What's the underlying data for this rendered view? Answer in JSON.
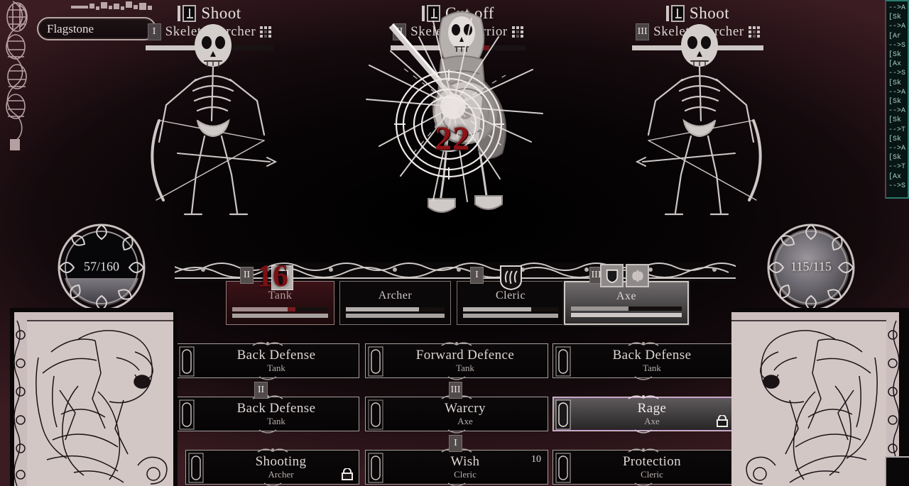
{
  "location": {
    "name": "Flagstone"
  },
  "enemies": [
    {
      "intent": "Shoot",
      "name": "Skeleton archer",
      "rank": "I",
      "hp_percent": 55,
      "dmg_percent": 0,
      "targeted": false,
      "icon": "bow-target-icon"
    },
    {
      "intent": "Cut off",
      "name": "Skeleton warrior",
      "rank": "II",
      "hp_percent": 63,
      "dmg_percent": 10,
      "targeted": true,
      "icon": "sword-target-icon"
    },
    {
      "intent": "Shoot",
      "name": "Skeleton archer",
      "rank": "III",
      "hp_percent": 100,
      "dmg_percent": 0,
      "targeted": false,
      "icon": "bow-target-icon"
    }
  ],
  "floating_damage": [
    {
      "value": "22",
      "target": "skeleton-warrior"
    },
    {
      "value": "16",
      "target": "tank"
    }
  ],
  "orbs": {
    "left": {
      "value": "57/160",
      "fill_percent": 36,
      "label": "health-orb"
    },
    "right": {
      "value": "115/115",
      "fill_percent": 100,
      "label": "resource-orb"
    }
  },
  "party": [
    {
      "name": "Tank",
      "initiative": "II",
      "crest": "shield-crest",
      "hp_percent": 58,
      "hp_damage_percent": 8,
      "mp_percent": 100,
      "state": "damaged",
      "statuses": []
    },
    {
      "name": "Archer",
      "initiative": "",
      "crest": "",
      "hp_percent": 74,
      "hp_damage_percent": 0,
      "mp_percent": 100,
      "state": "normal",
      "statuses": []
    },
    {
      "name": "Cleric",
      "initiative": "I",
      "crest": "flame-crest",
      "hp_percent": 72,
      "hp_damage_percent": 0,
      "mp_percent": 100,
      "state": "normal",
      "statuses": []
    },
    {
      "name": "Axe",
      "initiative": "III",
      "crest": "",
      "hp_percent": 52,
      "hp_damage_percent": 0,
      "mp_percent": 100,
      "state": "selected",
      "statuses": [
        "shield-buff-icon",
        "axe-buff-icon"
      ]
    }
  ],
  "abilities": [
    {
      "title": "Back Defense",
      "owner": "Tank",
      "cost": "",
      "locked": false,
      "highlighted": false
    },
    {
      "title": "Forward Defence",
      "owner": "Tank",
      "cost": "",
      "locked": false,
      "highlighted": false
    },
    {
      "title": "Back Defense",
      "owner": "Tank",
      "cost": "",
      "locked": false,
      "highlighted": false
    },
    {
      "title": "Back Defense",
      "owner": "Tank",
      "cost": "",
      "locked": false,
      "highlighted": false
    },
    {
      "title": "Warcry",
      "owner": "Axe",
      "cost": "",
      "locked": false,
      "highlighted": false
    },
    {
      "title": "Rage",
      "owner": "Axe",
      "cost": "",
      "locked": true,
      "highlighted": true
    },
    {
      "title": "Shooting",
      "owner": "Archer",
      "cost": "",
      "locked": true,
      "highlighted": false
    },
    {
      "title": "Wish",
      "owner": "Cleric",
      "cost": "10",
      "locked": false,
      "highlighted": false
    },
    {
      "title": "Protection",
      "owner": "Cleric",
      "cost": "",
      "locked": false,
      "highlighted": false
    }
  ],
  "ability_markers": [
    {
      "label": "II",
      "col": 0,
      "row": 0
    },
    {
      "label": "III",
      "col": 1,
      "row": 0
    },
    {
      "label": "I",
      "col": 1,
      "row": 1
    }
  ],
  "combat_log": [
    "-->A",
    "[Sk",
    "-->A",
    "[Ar",
    "-->S",
    "[Sk",
    "[Ax",
    "-->S",
    "[Sk",
    "-->A",
    "[Sk",
    "-->A",
    "[Sk",
    "-->T",
    "[Sk",
    "-->A",
    "[Sk",
    "-->T",
    "[Ax",
    "-->S"
  ],
  "colors": {
    "accent_red": "#8e1216",
    "parchment": "#d8cdcb",
    "log_green": "#a8cfc6",
    "highlight_magenta": "#c98bd2"
  }
}
